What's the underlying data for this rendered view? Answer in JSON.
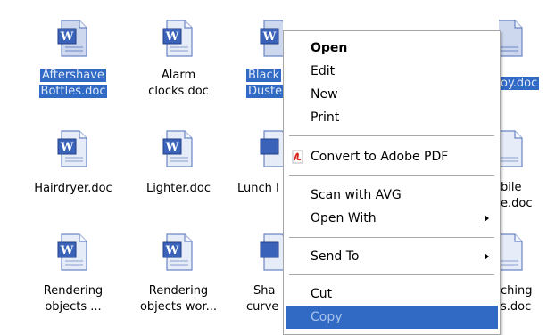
{
  "files": [
    {
      "label": [
        "Aftershave",
        "Bottles.doc"
      ],
      "selected": true
    },
    {
      "label": [
        "Alarm",
        "clocks.doc"
      ],
      "selected": false
    },
    {
      "label": [
        "Black",
        "Duste"
      ],
      "selected": true
    },
    {
      "label": [
        "oy.doc"
      ],
      "selected": true
    },
    {
      "label": [
        "Hairdryer.doc"
      ],
      "selected": false
    },
    {
      "label": [
        "Lighter.doc"
      ],
      "selected": false
    },
    {
      "label": [
        "Lunch I"
      ],
      "selected": false
    },
    {
      "label": [
        "bile",
        "e.doc"
      ],
      "selected": false
    },
    {
      "label": [
        "Rendering",
        "objects ..."
      ],
      "selected": false
    },
    {
      "label": [
        "Rendering",
        "objects wor..."
      ],
      "selected": false
    },
    {
      "label": [
        "Sha",
        "curve"
      ],
      "selected": false
    },
    {
      "label": [
        "ching",
        "s.doc"
      ],
      "selected": false
    }
  ],
  "menu": {
    "items": [
      {
        "label": "Open"
      },
      {
        "label": "Edit"
      },
      {
        "label": "New"
      },
      {
        "label": "Print"
      },
      {
        "label": "Convert to Adobe PDF"
      },
      {
        "label": "Scan with AVG"
      },
      {
        "label": "Open With"
      },
      {
        "label": "Send To"
      },
      {
        "label": "Cut"
      },
      {
        "label": "Copy"
      }
    ]
  },
  "colors": {
    "selection": "#316ac5",
    "word_icon_blue": "#3a62b9",
    "pdf_red": "#d8261c"
  },
  "icons": {
    "document": "word-document-icon",
    "pdf": "adobe-pdf-icon",
    "submenu": "submenu-arrow-icon"
  }
}
